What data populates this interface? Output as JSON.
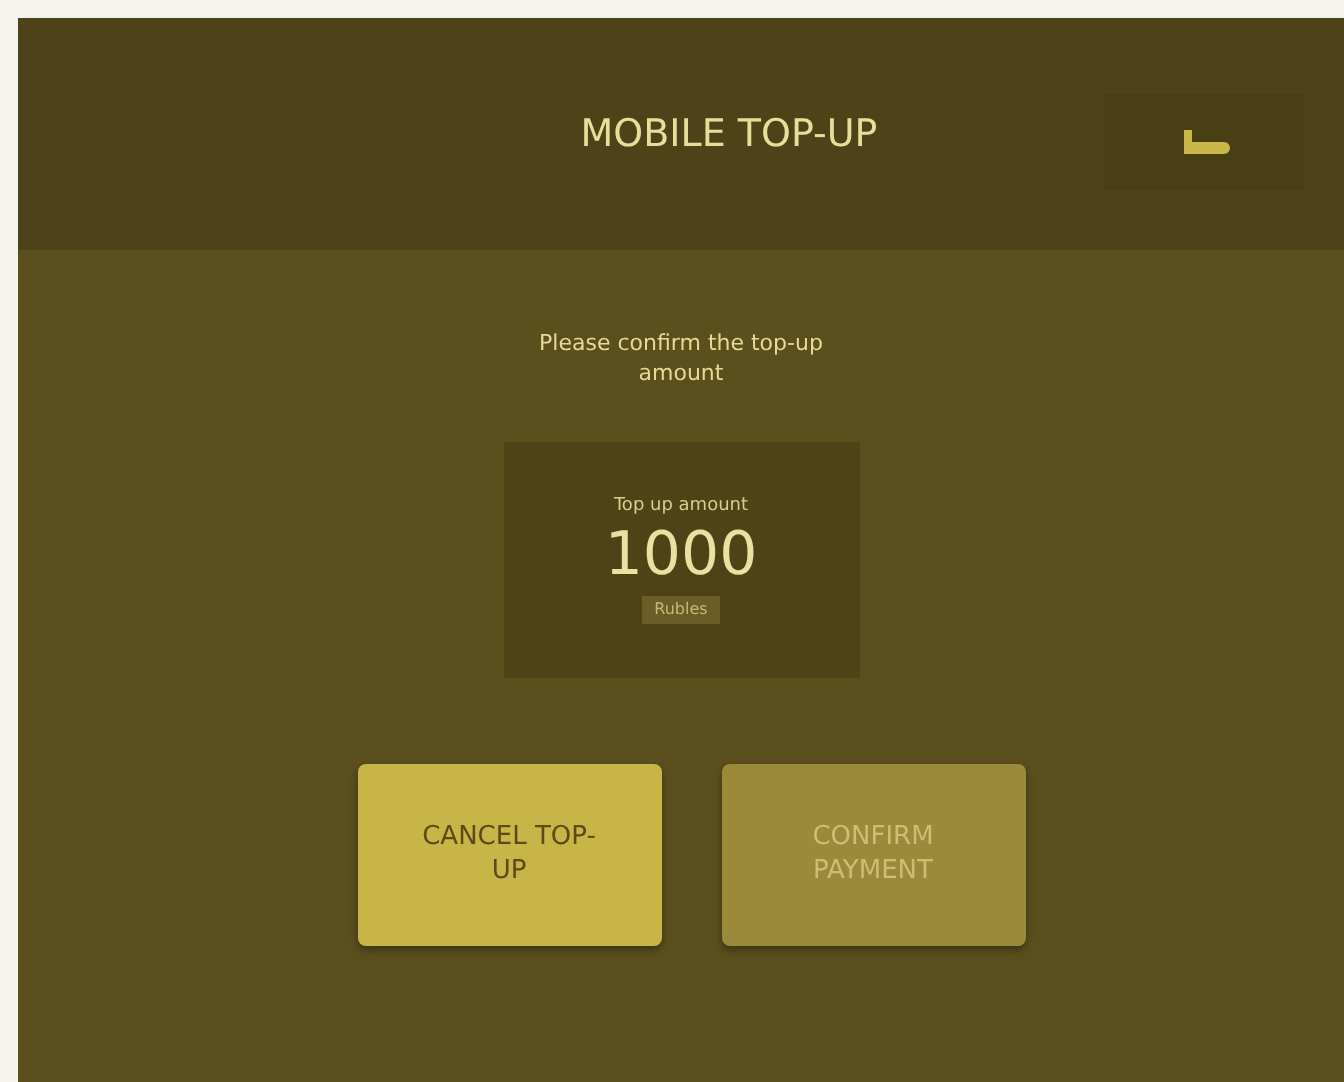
{
  "header": {
    "title": "MOBILE TOP-UP"
  },
  "prompt": "Please confirm the top-up amount",
  "amount_card": {
    "label": "Top up amount",
    "value": "1000",
    "unit": "Rubles"
  },
  "buttons": [
    {
      "label": "CANCEL TOP-UP",
      "disabled": false
    },
    {
      "label": "CONFIRM PAYMENT",
      "disabled": true
    }
  ]
}
